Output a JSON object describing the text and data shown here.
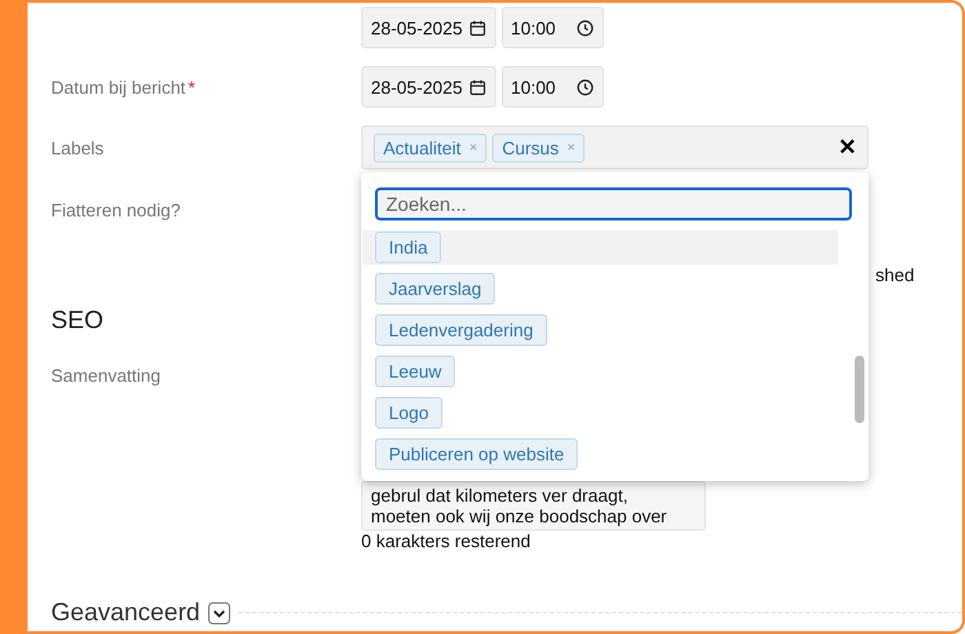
{
  "date_rows": [
    {
      "date": "28-05-2025",
      "time": "10:00"
    },
    {
      "label": "Datum bij bericht",
      "required_mark": "*",
      "date": "28-05-2025",
      "time": "10:00"
    }
  ],
  "labels_field": {
    "label": "Labels",
    "tags": [
      "Actualiteit",
      "Cursus"
    ],
    "remove": "×",
    "clear": "✕"
  },
  "dropdown": {
    "placeholder": "Zoeken...",
    "options": [
      {
        "label": "India",
        "highlighted": true
      },
      {
        "label": "Jaarverslag",
        "highlighted": false
      },
      {
        "label": "Ledenvergadering",
        "highlighted": false
      },
      {
        "label": "Leeuw",
        "highlighted": false
      },
      {
        "label": "Logo",
        "highlighted": false
      },
      {
        "label": "Publiceren op website",
        "highlighted": false
      }
    ]
  },
  "fiatteren": {
    "label": "Fiatteren nodig?",
    "option_tail": "shed"
  },
  "seo": {
    "heading": "SEO",
    "summary_label": "Samenvatting",
    "summary_lines": [
      "gebrul dat kilometers ver draagt,",
      "moeten ook wij onze boodschap over"
    ],
    "remaining": "0 karakters resterend"
  },
  "advanced": {
    "heading": "Geavanceerd"
  }
}
